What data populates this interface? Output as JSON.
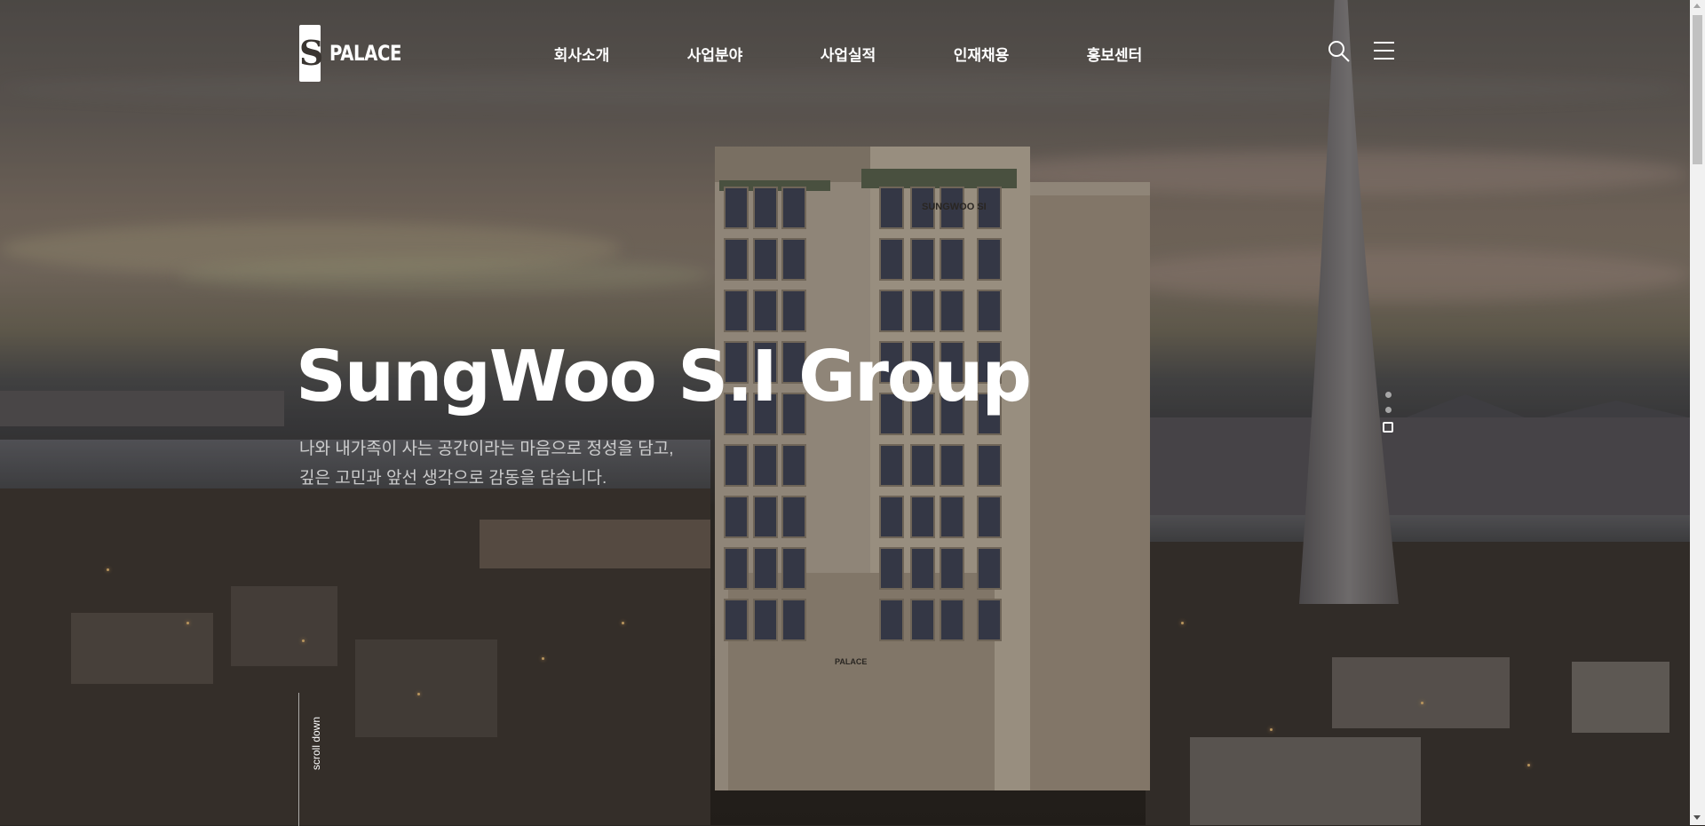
{
  "brand": {
    "name": "PALACE",
    "mark_glyph": "S"
  },
  "nav": {
    "items": [
      {
        "label": "회사소개"
      },
      {
        "label": "사업분야"
      },
      {
        "label": "사업실적"
      },
      {
        "label": "인재채용"
      },
      {
        "label": "홍보센터"
      }
    ]
  },
  "utility": {
    "search_icon": "search-icon",
    "menu_icon": "hamburger-menu-icon"
  },
  "hero": {
    "title": "SungWoo S.I Group",
    "subtitle_line1": "나와 내가족이 사는 공간이라는 마음으로 정성을 담고,",
    "subtitle_line2": "깊은 고민과 앞선 생각으로 감동을 담습니다.",
    "building_sign": "SUNGWOO SI",
    "building_logo": "PALACE"
  },
  "pager": {
    "count": 3,
    "active_index": 2
  },
  "scroll_hint": {
    "label": "scroll down"
  },
  "colors": {
    "text": "#ffffff",
    "overlay": "#2a2622",
    "city_light": "#f4c57a"
  }
}
